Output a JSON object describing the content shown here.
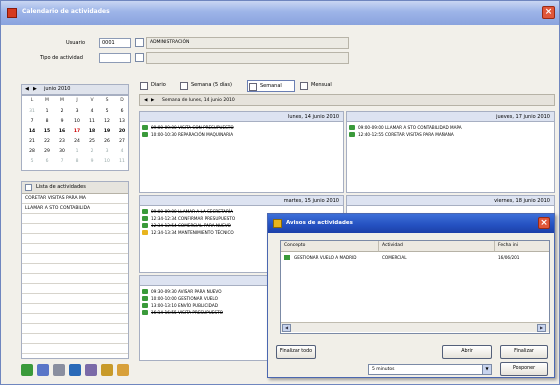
{
  "window": {
    "title": "Calendario de actividades"
  },
  "filters": {
    "usuario_label": "Usuario",
    "usuario_value": "0001",
    "usuario_name": "ADMINISTRACIÓN",
    "tipo_label": "Tipo de actividad",
    "tipo_value": "",
    "tipo_name": ""
  },
  "calendar": {
    "month_label": "junio 2010",
    "weekdays": [
      "L",
      "M",
      "M",
      "J",
      "V",
      "S",
      "D"
    ],
    "rows": [
      [
        "31",
        "1",
        "2",
        "3",
        "4",
        "5",
        "6"
      ],
      [
        "7",
        "8",
        "9",
        "10",
        "11",
        "12",
        "13"
      ],
      [
        "14",
        "15",
        "16",
        "17",
        "18",
        "19",
        "20"
      ],
      [
        "21",
        "22",
        "23",
        "24",
        "25",
        "26",
        "27"
      ],
      [
        "28",
        "29",
        "30",
        "1",
        "2",
        "3",
        "4"
      ],
      [
        "5",
        "6",
        "7",
        "8",
        "9",
        "10",
        "11"
      ]
    ]
  },
  "activity_list": {
    "header": "Lista de actividades",
    "items": [
      "CORETAR VISITAS PARA MA",
      "LLAMAR A STO CONTABILIDA"
    ]
  },
  "tabs": [
    {
      "label": "Diario"
    },
    {
      "label": "Semana (5 días)"
    },
    {
      "label": "Semanal"
    },
    {
      "label": "Mensual"
    }
  ],
  "week_label": "Semana de lunes, 14 junio 2010",
  "days": [
    {
      "date": "lunes, 14 junio 2010",
      "events": [
        {
          "text": "09:00-09:00 VISITA CON PRESUPUESTO",
          "strike": true,
          "icon": "check-icon"
        },
        {
          "text": "10:00-10:30 REPARACIÓN MAQUINARIA",
          "strike": false,
          "icon": "check-icon"
        }
      ]
    },
    {
      "date": "jueves, 17 junio 2010",
      "events": [
        {
          "text": "09:00-09:00 LLAMAR A STO CONTABILIDAD MAPA",
          "strike": false,
          "icon": "check-icon"
        },
        {
          "text": "12:40-12:55 CORETAR VISITAS PARA MAÑANA",
          "strike": false,
          "icon": "check-icon"
        }
      ]
    },
    {
      "date": "martes, 15 junio 2010",
      "events": [
        {
          "text": "09:00-09:00 LLAMAR A LA SECRETARÍA",
          "strike": true,
          "icon": "check-icon"
        },
        {
          "text": "12:34-12:34 CONFIRMAR PRESUPUESTO",
          "strike": false,
          "icon": "check-icon"
        },
        {
          "text": "12:34-12:54 COMERCIAL PARA NUEVO",
          "strike": true,
          "icon": "check-icon"
        },
        {
          "text": "12:34-13:34 MANTENIMIENTO TÉCNICO",
          "strike": false,
          "icon": "warning-icon"
        }
      ]
    },
    {
      "date": "viernes, 18 junio 2010",
      "events": []
    },
    {
      "date": "miércoles, 16 junio 2010",
      "events": [
        {
          "text": "09:30-09:30 AVISAR PARA NUEVO",
          "strike": false,
          "icon": "check-icon"
        },
        {
          "text": "10:00-10:00 GESTIONAR VUELO",
          "strike": false,
          "icon": "check-icon"
        },
        {
          "text": "13:00-13:10 ENVÍO PUBLICIDAD",
          "strike": false,
          "icon": "check-icon"
        },
        {
          "text": "16:14-16:55 VISITA PRESUPUESTO",
          "strike": true,
          "icon": "check-icon"
        }
      ]
    }
  ],
  "dialog": {
    "title": "Avisos de actividades",
    "columns": [
      "Concepto",
      "Actividad",
      "Fecha ini"
    ],
    "rows": [
      {
        "concepto": "GESTIONAR VUELO A MADRID",
        "actividad": "COMERCIAL",
        "fecha": "16/06/201"
      }
    ],
    "btn_finalizar_todo": "Finalizar todo",
    "btn_abrir": "Abrir",
    "btn_finalizar": "Finalizar",
    "postpone_select": "5 minutos",
    "btn_posponer": "Posponer"
  },
  "toolbar_icons": [
    "refresh-icon",
    "user-icon",
    "link-icon",
    "chart-icon",
    "print-icon",
    "filter-icon",
    "group-icon"
  ]
}
